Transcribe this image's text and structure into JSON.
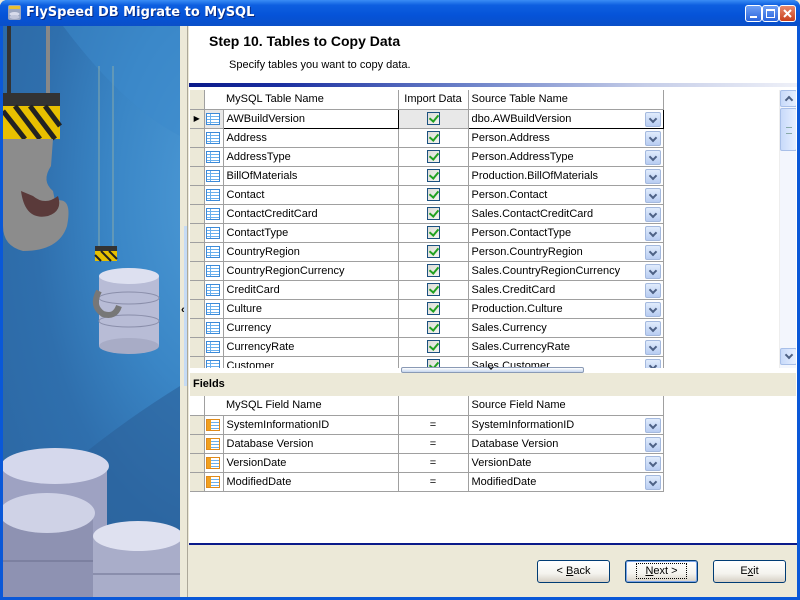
{
  "window": {
    "title": "FlySpeed DB Migrate to MySQL",
    "controls": [
      "minimize",
      "maximize",
      "close"
    ]
  },
  "header": {
    "title": "Step 10. Tables to Copy Data",
    "subtitle": "Specify tables you want to copy data."
  },
  "tables_grid": {
    "columns": [
      "MySQL Table Name",
      "Import Data",
      "Source Table Name"
    ],
    "selected_row": 0,
    "rows": [
      {
        "mysql": "AWBuildVersion",
        "import": true,
        "source": "dbo.AWBuildVersion"
      },
      {
        "mysql": "Address",
        "import": true,
        "source": "Person.Address"
      },
      {
        "mysql": "AddressType",
        "import": true,
        "source": "Person.AddressType"
      },
      {
        "mysql": "BillOfMaterials",
        "import": true,
        "source": "Production.BillOfMaterials"
      },
      {
        "mysql": "Contact",
        "import": true,
        "source": "Person.Contact"
      },
      {
        "mysql": "ContactCreditCard",
        "import": true,
        "source": "Sales.ContactCreditCard"
      },
      {
        "mysql": "ContactType",
        "import": true,
        "source": "Person.ContactType"
      },
      {
        "mysql": "CountryRegion",
        "import": true,
        "source": "Person.CountryRegion"
      },
      {
        "mysql": "CountryRegionCurrency",
        "import": true,
        "source": "Sales.CountryRegionCurrency"
      },
      {
        "mysql": "CreditCard",
        "import": true,
        "source": "Sales.CreditCard"
      },
      {
        "mysql": "Culture",
        "import": true,
        "source": "Production.Culture"
      },
      {
        "mysql": "Currency",
        "import": true,
        "source": "Sales.Currency"
      },
      {
        "mysql": "CurrencyRate",
        "import": true,
        "source": "Sales.CurrencyRate"
      },
      {
        "mysql": "Customer",
        "import": true,
        "source": "Sales.Customer"
      }
    ]
  },
  "fields": {
    "label": "Fields",
    "columns": [
      "MySQL Field Name",
      "",
      "Source Field Name"
    ],
    "rows": [
      {
        "mysql": "SystemInformationID",
        "op": "=",
        "source": "SystemInformationID"
      },
      {
        "mysql": "Database Version",
        "op": "=",
        "source": "Database Version"
      },
      {
        "mysql": "VersionDate",
        "op": "=",
        "source": "VersionDate"
      },
      {
        "mysql": "ModifiedDate",
        "op": "=",
        "source": "ModifiedDate"
      }
    ]
  },
  "buttons": {
    "back": {
      "pre": "< ",
      "accel": "B",
      "post": "ack"
    },
    "next": {
      "pre": "",
      "accel": "N",
      "post": "ext >"
    },
    "exit": {
      "pre": "E",
      "accel": "x",
      "post": "it"
    }
  },
  "icons": {
    "table_row_icon": "table-icon",
    "field_row_icon": "field-icon",
    "row_indicator": "current-row-arrow-icon",
    "dropdown": "chevron-down-icon"
  }
}
